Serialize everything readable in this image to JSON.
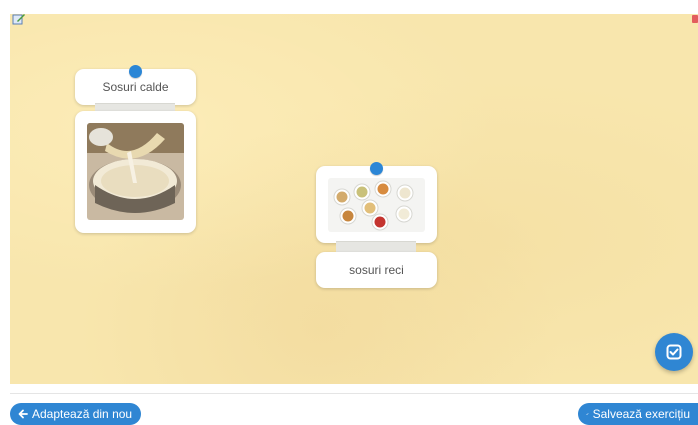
{
  "cards": {
    "card1_label": "Sosuri calde",
    "card2_label": "sosuri reci"
  },
  "footer": {
    "reset_label": "Adaptează din nou",
    "save_label": "Salvează exercițiu"
  },
  "icons": {
    "edit": "edit-icon",
    "check_fab": "checklist-icon",
    "back_arrow": "arrow-left-icon",
    "save_check": "checkmark-icon"
  },
  "colors": {
    "board_bg": "#f8e6ad",
    "accent_blue": "#2f86d3",
    "pin_blue": "#2b86d6"
  }
}
